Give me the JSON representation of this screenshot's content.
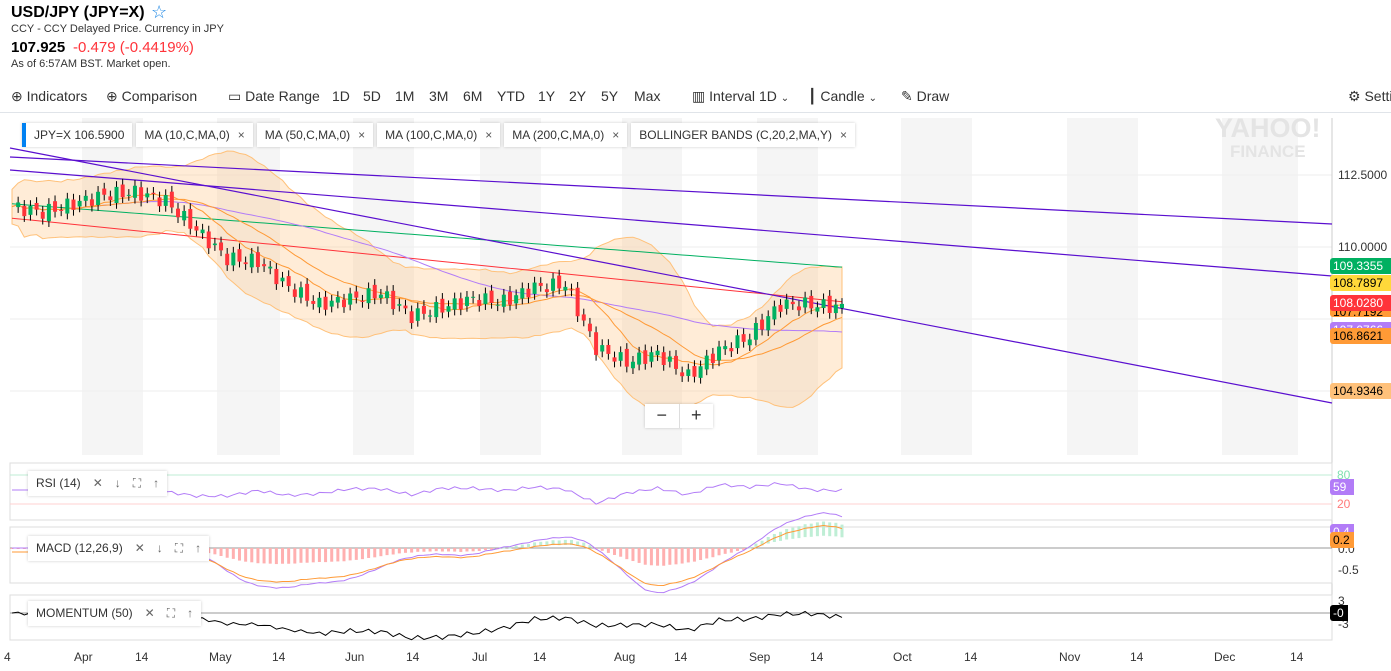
{
  "header": {
    "title": "USD/JPY (JPY=X)",
    "subtitle": "CCY - CCY Delayed Price. Currency in JPY",
    "price": "107.925",
    "change": "-0.479 (-0.4419%)",
    "as_of": "As of 6:57AM BST. Market open."
  },
  "toolbar": {
    "indicators": "Indicators",
    "comparison": "Comparison",
    "date_range": "Date Range",
    "ranges": [
      "1D",
      "5D",
      "1M",
      "3M",
      "6M",
      "YTD",
      "1Y",
      "2Y",
      "5Y",
      "Max"
    ],
    "interval_label": "Interval",
    "interval": "1D",
    "chart_type": "Candle",
    "draw": "Draw",
    "settings": "Settings"
  },
  "tags": [
    {
      "label": "JPY=X  106.5900"
    },
    {
      "label": "MA (10,C,MA,0)"
    },
    {
      "label": "MA (50,C,MA,0)"
    },
    {
      "label": "MA (100,C,MA,0)"
    },
    {
      "label": "MA (200,C,MA,0)"
    },
    {
      "label": "BOLLINGER BANDS (C,20,2,MA,Y)"
    }
  ],
  "close_x": "×",
  "logo": {
    "line1": "YAHOO!",
    "line2": "FINANCE"
  },
  "y_axis": [
    "112.5000",
    "110.0000"
  ],
  "price_labels": [
    {
      "v": "109.3355",
      "bg": "#00b061",
      "fg": "#fff"
    },
    {
      "v": "108.7897",
      "bg": "#ffd83a",
      "fg": "#000"
    },
    {
      "v": "107.7192",
      "bg": "#ff9a36",
      "fg": "#000"
    },
    {
      "v": "108.0280",
      "bg": "#ff333a",
      "fg": "#fff"
    },
    {
      "v": "107.0766",
      "bg": "#b27cf7",
      "fg": "#fff"
    },
    {
      "v": "106.8621",
      "bg": "#ff9a36",
      "fg": "#000"
    },
    {
      "v": "104.9346",
      "bg": "#ffc17a",
      "fg": "#000"
    }
  ],
  "indicators": {
    "rsi": {
      "label": "RSI (14)",
      "value": "59",
      "levels": [
        "80",
        "20"
      ]
    },
    "macd": {
      "label": "MACD (12,26,9)",
      "values": [
        "0.4",
        "0.2"
      ],
      "axis": [
        "0.0",
        "-0.5"
      ]
    },
    "momentum": {
      "label": "MOMENTUM (50)",
      "value": "-0",
      "axis": [
        "3",
        "-3"
      ]
    }
  },
  "x_axis": [
    "4",
    "Apr",
    "14",
    "May",
    "14",
    "Jun",
    "14",
    "Jul",
    "14",
    "Aug",
    "14",
    "Sep",
    "14",
    "Oct",
    "14",
    "Nov",
    "14",
    "Dec",
    "14"
  ],
  "colors": {
    "up": "#00b061",
    "down": "#ff333a",
    "trend": "#5a0fcf",
    "ma200": "#00b061",
    "ma100": "#ff333a",
    "ma50": "#b27cf7",
    "ma10": "#ff9a36",
    "band": "#ffc17a"
  },
  "price_series_weekly_close": [
    111.4,
    111.2,
    111.5,
    111.8,
    111.9,
    111.6,
    110.6,
    109.6,
    109.5,
    108.6,
    108.0,
    108.2,
    108.4,
    107.6,
    107.9,
    108.2,
    108.1,
    108.6,
    108.7,
    106.5,
    106.0,
    106.3,
    105.5,
    106.4,
    106.9,
    108.0,
    108.0,
    107.9
  ]
}
